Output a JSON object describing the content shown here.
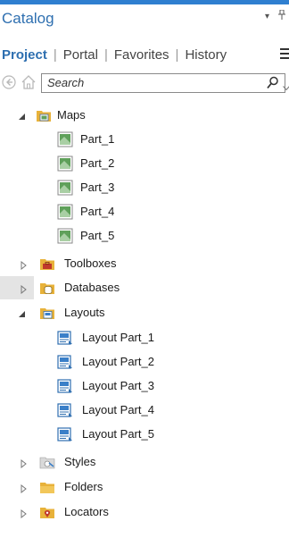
{
  "pane": {
    "title": "Catalog",
    "controls": {
      "menu_glyph": "▾",
      "pin_glyph": "⊥"
    }
  },
  "tabs": [
    {
      "label": "Project",
      "active": true
    },
    {
      "label": "Portal",
      "active": false
    },
    {
      "label": "Favorites",
      "active": false
    },
    {
      "label": "History",
      "active": false
    }
  ],
  "search": {
    "placeholder": "Search",
    "value": ""
  },
  "tree": {
    "maps": {
      "label": "Maps",
      "expanded": true,
      "items": [
        "Part_1",
        "Part_2",
        "Part_3",
        "Part_4",
        "Part_5"
      ]
    },
    "toolboxes": {
      "label": "Toolboxes",
      "expanded": false
    },
    "databases": {
      "label": "Databases",
      "expanded": false
    },
    "layouts": {
      "label": "Layouts",
      "expanded": true,
      "items": [
        "Layout Part_1",
        "Layout Part_2",
        "Layout Part_3",
        "Layout Part_4",
        "Layout Part_5"
      ]
    },
    "styles": {
      "label": "Styles",
      "expanded": false
    },
    "folders": {
      "label": "Folders",
      "expanded": false
    },
    "locators": {
      "label": "Locators",
      "expanded": false
    }
  },
  "colors": {
    "accent": "#2f7fd0",
    "title_text": "#2e6fb0",
    "folder_yellow": "#e8b23a",
    "map_green": "#5fa05a"
  }
}
